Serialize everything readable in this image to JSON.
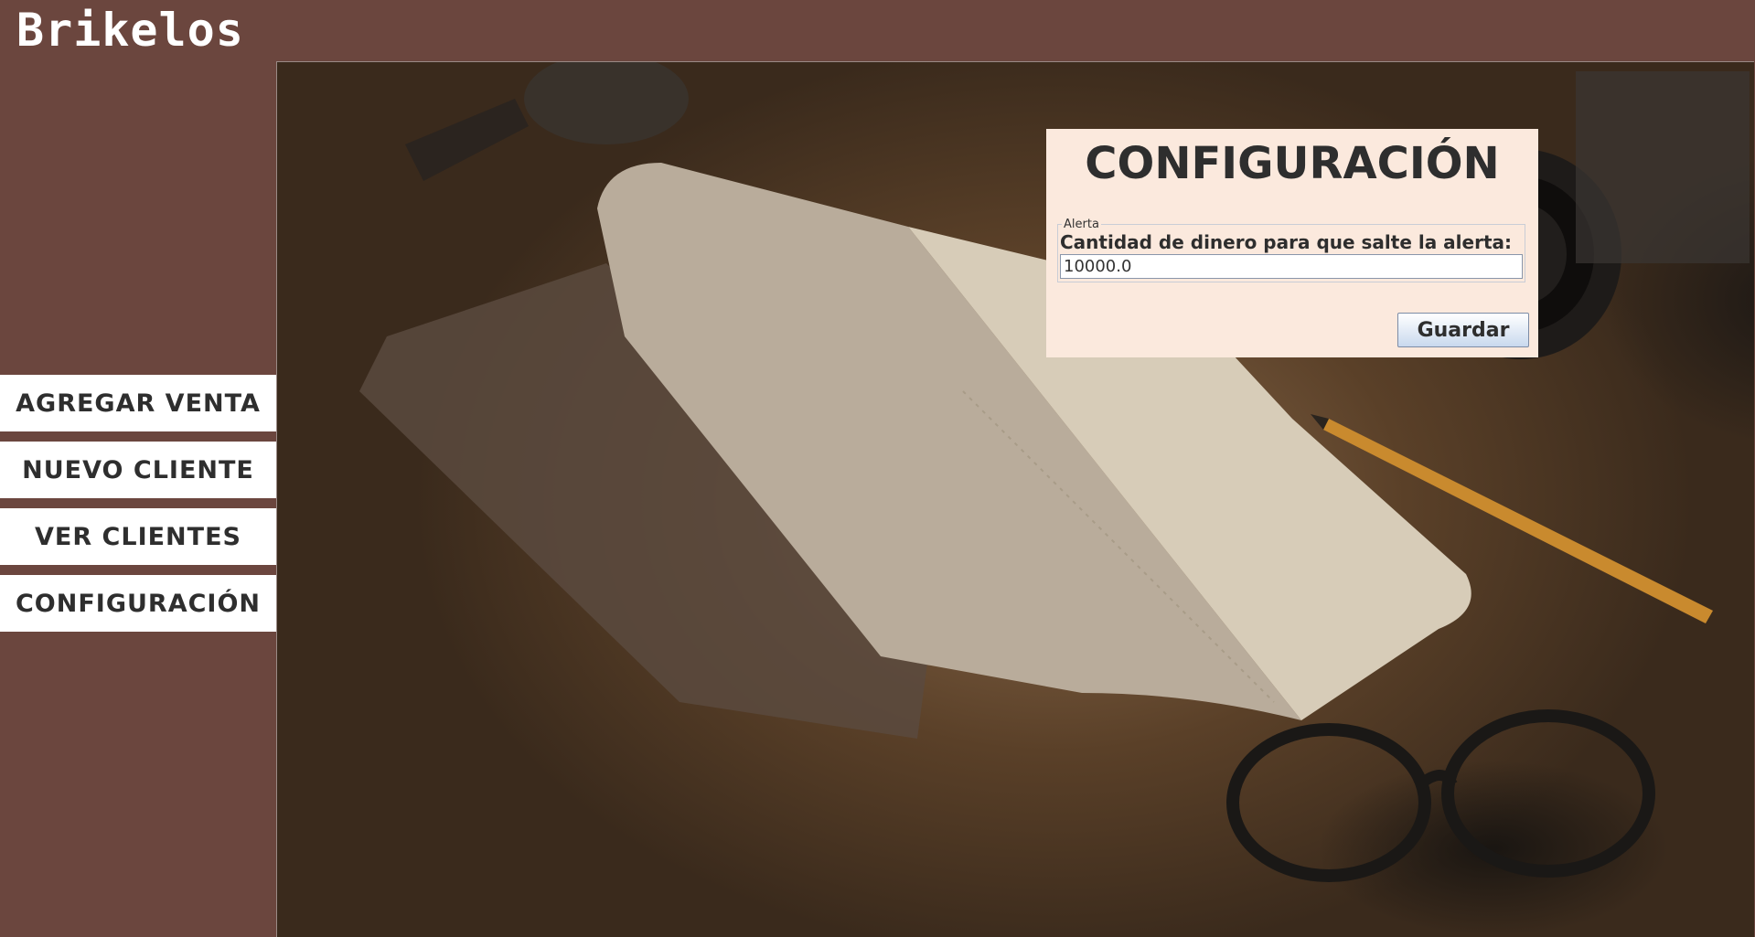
{
  "app": {
    "title": "Brikelos"
  },
  "sidebar": {
    "items": [
      {
        "label": "AGREGAR VENTA"
      },
      {
        "label": "NUEVO CLIENTE"
      },
      {
        "label": "VER CLIENTES"
      },
      {
        "label": "CONFIGURACIÓN"
      }
    ]
  },
  "panel": {
    "title": "CONFIGURACIÓN",
    "group_legend": "Alerta",
    "field_label": "Cantidad de dinero para que salte la alerta:",
    "field_value": "10000.0",
    "save_label": "Guardar"
  },
  "colors": {
    "background": "#6b463e",
    "panel": "#fbe9dd",
    "text": "#2e2e2e"
  }
}
